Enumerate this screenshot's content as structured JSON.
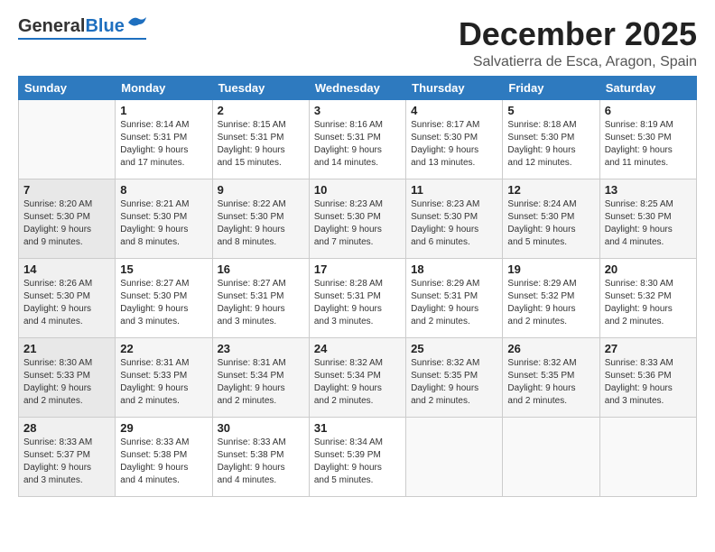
{
  "header": {
    "logo_general": "General",
    "logo_blue": "Blue",
    "month_title": "December 2025",
    "location": "Salvatierra de Esca, Aragon, Spain"
  },
  "weekdays": [
    "Sunday",
    "Monday",
    "Tuesday",
    "Wednesday",
    "Thursday",
    "Friday",
    "Saturday"
  ],
  "weeks": [
    [
      {
        "day": "",
        "info": ""
      },
      {
        "day": "1",
        "info": "Sunrise: 8:14 AM\nSunset: 5:31 PM\nDaylight: 9 hours\nand 17 minutes."
      },
      {
        "day": "2",
        "info": "Sunrise: 8:15 AM\nSunset: 5:31 PM\nDaylight: 9 hours\nand 15 minutes."
      },
      {
        "day": "3",
        "info": "Sunrise: 8:16 AM\nSunset: 5:31 PM\nDaylight: 9 hours\nand 14 minutes."
      },
      {
        "day": "4",
        "info": "Sunrise: 8:17 AM\nSunset: 5:30 PM\nDaylight: 9 hours\nand 13 minutes."
      },
      {
        "day": "5",
        "info": "Sunrise: 8:18 AM\nSunset: 5:30 PM\nDaylight: 9 hours\nand 12 minutes."
      },
      {
        "day": "6",
        "info": "Sunrise: 8:19 AM\nSunset: 5:30 PM\nDaylight: 9 hours\nand 11 minutes."
      }
    ],
    [
      {
        "day": "7",
        "info": "Sunrise: 8:20 AM\nSunset: 5:30 PM\nDaylight: 9 hours\nand 9 minutes."
      },
      {
        "day": "8",
        "info": "Sunrise: 8:21 AM\nSunset: 5:30 PM\nDaylight: 9 hours\nand 8 minutes."
      },
      {
        "day": "9",
        "info": "Sunrise: 8:22 AM\nSunset: 5:30 PM\nDaylight: 9 hours\nand 8 minutes."
      },
      {
        "day": "10",
        "info": "Sunrise: 8:23 AM\nSunset: 5:30 PM\nDaylight: 9 hours\nand 7 minutes."
      },
      {
        "day": "11",
        "info": "Sunrise: 8:23 AM\nSunset: 5:30 PM\nDaylight: 9 hours\nand 6 minutes."
      },
      {
        "day": "12",
        "info": "Sunrise: 8:24 AM\nSunset: 5:30 PM\nDaylight: 9 hours\nand 5 minutes."
      },
      {
        "day": "13",
        "info": "Sunrise: 8:25 AM\nSunset: 5:30 PM\nDaylight: 9 hours\nand 4 minutes."
      }
    ],
    [
      {
        "day": "14",
        "info": "Sunrise: 8:26 AM\nSunset: 5:30 PM\nDaylight: 9 hours\nand 4 minutes."
      },
      {
        "day": "15",
        "info": "Sunrise: 8:27 AM\nSunset: 5:30 PM\nDaylight: 9 hours\nand 3 minutes."
      },
      {
        "day": "16",
        "info": "Sunrise: 8:27 AM\nSunset: 5:31 PM\nDaylight: 9 hours\nand 3 minutes."
      },
      {
        "day": "17",
        "info": "Sunrise: 8:28 AM\nSunset: 5:31 PM\nDaylight: 9 hours\nand 3 minutes."
      },
      {
        "day": "18",
        "info": "Sunrise: 8:29 AM\nSunset: 5:31 PM\nDaylight: 9 hours\nand 2 minutes."
      },
      {
        "day": "19",
        "info": "Sunrise: 8:29 AM\nSunset: 5:32 PM\nDaylight: 9 hours\nand 2 minutes."
      },
      {
        "day": "20",
        "info": "Sunrise: 8:30 AM\nSunset: 5:32 PM\nDaylight: 9 hours\nand 2 minutes."
      }
    ],
    [
      {
        "day": "21",
        "info": "Sunrise: 8:30 AM\nSunset: 5:33 PM\nDaylight: 9 hours\nand 2 minutes."
      },
      {
        "day": "22",
        "info": "Sunrise: 8:31 AM\nSunset: 5:33 PM\nDaylight: 9 hours\nand 2 minutes."
      },
      {
        "day": "23",
        "info": "Sunrise: 8:31 AM\nSunset: 5:34 PM\nDaylight: 9 hours\nand 2 minutes."
      },
      {
        "day": "24",
        "info": "Sunrise: 8:32 AM\nSunset: 5:34 PM\nDaylight: 9 hours\nand 2 minutes."
      },
      {
        "day": "25",
        "info": "Sunrise: 8:32 AM\nSunset: 5:35 PM\nDaylight: 9 hours\nand 2 minutes."
      },
      {
        "day": "26",
        "info": "Sunrise: 8:32 AM\nSunset: 5:35 PM\nDaylight: 9 hours\nand 2 minutes."
      },
      {
        "day": "27",
        "info": "Sunrise: 8:33 AM\nSunset: 5:36 PM\nDaylight: 9 hours\nand 3 minutes."
      }
    ],
    [
      {
        "day": "28",
        "info": "Sunrise: 8:33 AM\nSunset: 5:37 PM\nDaylight: 9 hours\nand 3 minutes."
      },
      {
        "day": "29",
        "info": "Sunrise: 8:33 AM\nSunset: 5:38 PM\nDaylight: 9 hours\nand 4 minutes."
      },
      {
        "day": "30",
        "info": "Sunrise: 8:33 AM\nSunset: 5:38 PM\nDaylight: 9 hours\nand 4 minutes."
      },
      {
        "day": "31",
        "info": "Sunrise: 8:34 AM\nSunset: 5:39 PM\nDaylight: 9 hours\nand 5 minutes."
      },
      {
        "day": "",
        "info": ""
      },
      {
        "day": "",
        "info": ""
      },
      {
        "day": "",
        "info": ""
      }
    ]
  ]
}
